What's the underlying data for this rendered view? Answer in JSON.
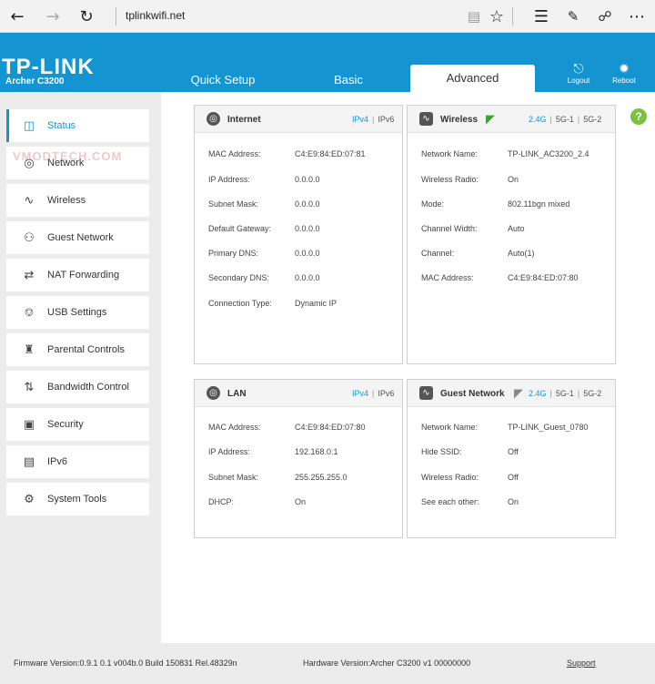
{
  "browser": {
    "url": "tplinkwifi.net",
    "back_icon": "arrow-left",
    "forward_icon": "arrow-right",
    "refresh_icon": "refresh"
  },
  "header": {
    "brand": "TP-LINK",
    "model": "Archer C3200",
    "tabs": [
      "Quick Setup",
      "Basic",
      "Advanced"
    ],
    "active_tab": "Advanced",
    "logout_label": "Logout",
    "reboot_label": "Reboot",
    "accent_color": "#1495d1"
  },
  "watermark": "VMODTECH.COM",
  "sidebar": {
    "items": [
      {
        "label": "Status",
        "icon": "status-icon"
      },
      {
        "label": "Network",
        "icon": "globe-icon"
      },
      {
        "label": "Wireless",
        "icon": "wireless-icon"
      },
      {
        "label": "Guest Network",
        "icon": "guest-icon"
      },
      {
        "label": "NAT Forwarding",
        "icon": "nat-icon"
      },
      {
        "label": "USB Settings",
        "icon": "usb-icon"
      },
      {
        "label": "Parental Controls",
        "icon": "parental-icon"
      },
      {
        "label": "Bandwidth Control",
        "icon": "bandwidth-icon"
      },
      {
        "label": "Security",
        "icon": "lock-icon"
      },
      {
        "label": "IPv6",
        "icon": "ipv6-icon"
      },
      {
        "label": "System Tools",
        "icon": "gear-icon"
      }
    ]
  },
  "internet": {
    "title": "Internet",
    "tab1": "IPv4",
    "tab2": "IPv6",
    "rows": [
      {
        "label": "MAC Address:",
        "value": "C4:E9:84:ED:07:81"
      },
      {
        "label": "IP Address:",
        "value": "0.0.0.0"
      },
      {
        "label": "Subnet Mask:",
        "value": "0.0.0.0"
      },
      {
        "label": "Default Gateway:",
        "value": "0.0.0.0"
      },
      {
        "label": "Primary DNS:",
        "value": "0.0.0.0"
      },
      {
        "label": "Secondary DNS:",
        "value": "0.0.0.0"
      },
      {
        "label": "Connection Type:",
        "value": "Dynamic IP"
      }
    ]
  },
  "wireless": {
    "title": "Wireless",
    "tab1": "2.4G",
    "tab2": "5G-1",
    "tab3": "5G-2",
    "rows": [
      {
        "label": "Network Name:",
        "value": "TP-LINK_AC3200_2.4"
      },
      {
        "label": "Wireless Radio:",
        "value": "On"
      },
      {
        "label": "Mode:",
        "value": "802.11bgn mixed"
      },
      {
        "label": "Channel Width:",
        "value": "Auto"
      },
      {
        "label": "Channel:",
        "value": "Auto(1)"
      },
      {
        "label": "MAC Address:",
        "value": "C4:E9:84:ED:07:80"
      }
    ]
  },
  "lan": {
    "title": "LAN",
    "tab1": "IPv4",
    "tab2": "IPv6",
    "rows": [
      {
        "label": "MAC Address:",
        "value": "C4:E9:84:ED:07:80"
      },
      {
        "label": "IP Address:",
        "value": "192.168.0.1"
      },
      {
        "label": "Subnet Mask:",
        "value": "255.255.255.0"
      },
      {
        "label": "DHCP:",
        "value": "On"
      }
    ]
  },
  "guest": {
    "title": "Guest Network",
    "tab1": "2.4G",
    "tab2": "5G-1",
    "tab3": "5G-2",
    "rows": [
      {
        "label": "Network Name:",
        "value": "TP-LINK_Guest_0780"
      },
      {
        "label": "Hide SSID:",
        "value": "Off"
      },
      {
        "label": "Wireless Radio:",
        "value": "Off"
      },
      {
        "label": "See each other:",
        "value": "On"
      }
    ]
  },
  "help_label": "?",
  "footer": {
    "firmware": "Firmware Version:0.9.1 0.1 v004b.0 Build 150831 Rel.48329n",
    "hardware": "Hardware Version:Archer C3200 v1 00000000",
    "support": "Support"
  }
}
